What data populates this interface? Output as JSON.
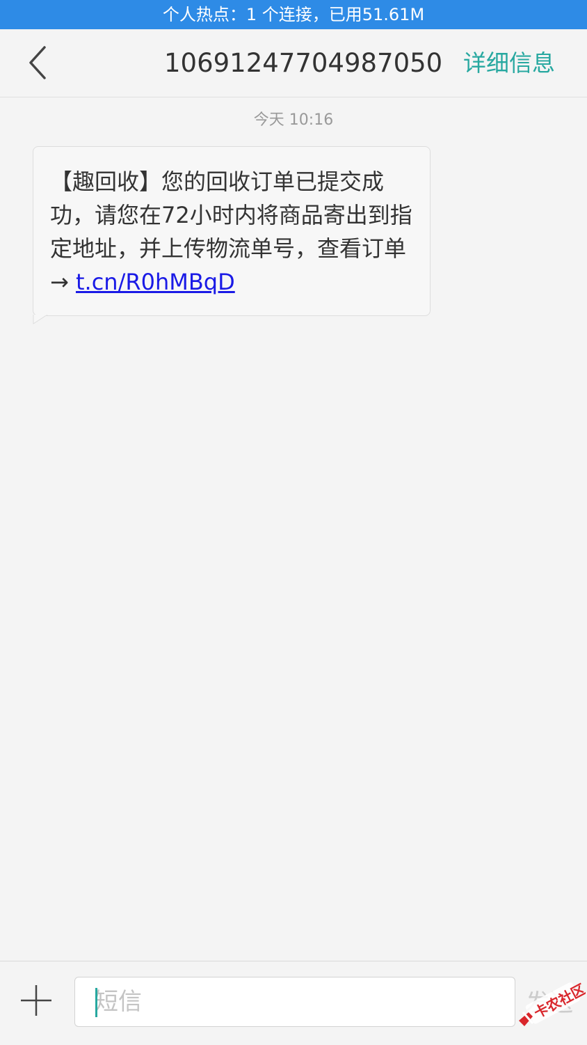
{
  "status_bar": {
    "text": "个人热点：1 个连接，已用51.61M"
  },
  "header": {
    "back_icon": "chevron-left-icon",
    "contact_number": "10691247704987050",
    "detail_label": "详细信息"
  },
  "conversation": {
    "timestamp": "今天 10:16",
    "messages": [
      {
        "direction": "incoming",
        "text": "【趣回收】您的回收订单已提交成功，请您在72小时内将商品寄出到指定地址，并上传物流单号，查看订单→ ",
        "link_text": "t.cn/R0hMBqD"
      }
    ]
  },
  "composer": {
    "add_icon": "plus-icon",
    "input_value": "",
    "input_placeholder": "短信",
    "send_label": "发送"
  },
  "colors": {
    "status_bar_bg": "#2e8be6",
    "accent": "#27a8a0",
    "link": "#1a1ae6",
    "background": "#f4f4f4"
  },
  "watermark": {
    "text": "卡农社区",
    "icon": "kanong-logo-icon"
  }
}
